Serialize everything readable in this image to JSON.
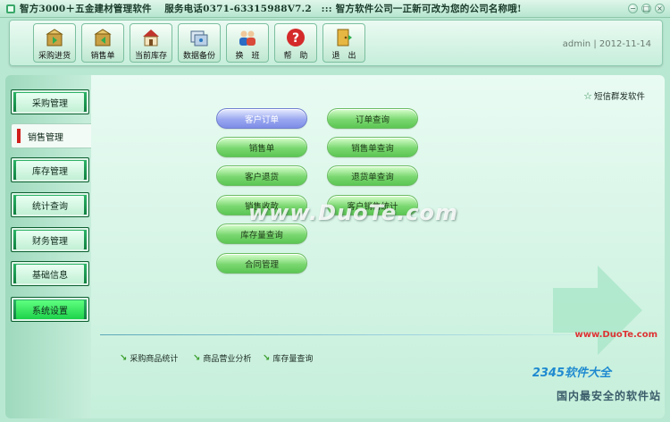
{
  "window": {
    "title": "智方3000＋五金建材管理软件　 服务电话0371-63315988V7.2　::: 智方软件公司一正新可改为您的公司名称哦!"
  },
  "toolbar": {
    "buttons": [
      {
        "label": "采购进货",
        "icon": "purchase-icon"
      },
      {
        "label": "销售单",
        "icon": "sales-icon"
      },
      {
        "label": "当前库存",
        "icon": "house-icon"
      },
      {
        "label": "数据备份",
        "icon": "backup-icon"
      },
      {
        "label": "换　班",
        "icon": "users-icon"
      },
      {
        "label": "帮　助",
        "icon": "help-icon"
      },
      {
        "label": "退　出",
        "icon": "exit-icon"
      }
    ],
    "user": "admin",
    "date": "2012-11-14"
  },
  "sidebar": {
    "items": [
      {
        "label": "采购管理"
      },
      {
        "label": "销售管理"
      },
      {
        "label": "库存管理"
      },
      {
        "label": "统计查询"
      },
      {
        "label": "财务管理"
      },
      {
        "label": "基础信息"
      },
      {
        "label": "系统设置"
      }
    ],
    "active_index": 1
  },
  "main": {
    "sms_link": "短信群发软件",
    "left_buttons": [
      "客户订单",
      "销售单",
      "客户退货",
      "销售收款",
      "库存量查询",
      "合同管理"
    ],
    "right_buttons": [
      "订单查询",
      "销售单查询",
      "退货单查询",
      "客户销售统计"
    ],
    "bottom_links": [
      "采购商品统计",
      "商品营业分析",
      "库存量查询"
    ]
  },
  "watermarks": {
    "duote": "www.DuoTe.com",
    "duote_small": "www.DuoTe.com",
    "brand": "2345软件大全",
    "slogan": "国内最安全的软件站"
  },
  "colors": {
    "accent_green": "#1aa955",
    "selected_blue": "#8594e8",
    "active_marker": "#d0201c"
  }
}
